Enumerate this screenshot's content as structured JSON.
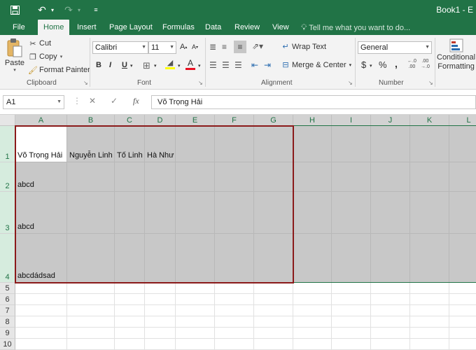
{
  "app": {
    "title": "Book1 - E"
  },
  "qat": {
    "save_icon": "save-icon",
    "undo_icon": "undo-icon",
    "redo_icon": "redo-icon",
    "customize_icon": "customize-qat-icon"
  },
  "tabs": [
    "File",
    "Home",
    "Insert",
    "Page Layout",
    "Formulas",
    "Data",
    "Review",
    "View"
  ],
  "active_tab": "Home",
  "tell_me": "Tell me what you want to do...",
  "ribbon": {
    "clipboard": {
      "paste": "Paste",
      "cut": "Cut",
      "copy": "Copy",
      "format_painter": "Format Painter",
      "label": "Clipboard"
    },
    "font": {
      "name": "Calibri",
      "size": "11",
      "bold": "B",
      "italic": "I",
      "underline": "U",
      "label": "Font"
    },
    "alignment": {
      "wrap_text": "Wrap Text",
      "merge_center": "Merge & Center",
      "label": "Alignment"
    },
    "number": {
      "format": "General",
      "currency": "$",
      "percent": "%",
      "comma": ",",
      "label": "Number"
    },
    "styles": {
      "conditional": "Conditional",
      "formatting": "Formatting"
    }
  },
  "formula_bar": {
    "name_box": "A1",
    "fx": "fx",
    "value": "Võ Trọng Hải"
  },
  "columns": [
    "A",
    "B",
    "C",
    "D",
    "E",
    "F",
    "G",
    "H",
    "I",
    "J",
    "K",
    "L"
  ],
  "rows": [
    "1",
    "2",
    "3",
    "4",
    "5",
    "6",
    "7",
    "8",
    "9",
    "10"
  ],
  "cells": {
    "A1": "Võ Trọng Hải",
    "B1": "Nguyễn Linh",
    "C1": "Tố Linh",
    "D1": "Hà Như",
    "A2": "abcd",
    "A3": "abcd",
    "A4": "abcdádsad"
  },
  "colors": {
    "accent": "#217346",
    "selection_border": "#8b1a1a",
    "selection_fill": "#c8c8c8"
  }
}
